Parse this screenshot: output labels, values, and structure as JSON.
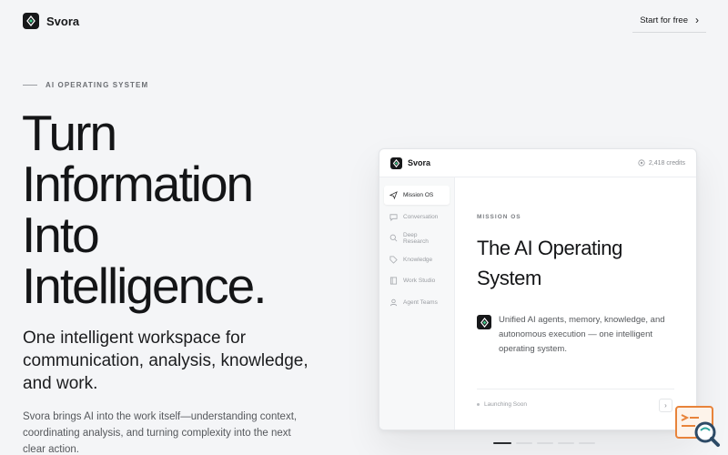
{
  "header": {
    "brand": "Svora",
    "cta_label": "Start for free",
    "cta_icon": "chevron-right-icon"
  },
  "hero": {
    "eyebrow": "AI OPERATING SYSTEM",
    "headline": [
      "Turn",
      "Information",
      "Into",
      "Intelligence."
    ],
    "subhead": "One intelligent workspace for communication, analysis, knowledge, and work.",
    "body": "Svora brings AI into the work itself—understanding context, coordinating analysis, and turning complexity into the next clear action."
  },
  "mock": {
    "brand": "Svora",
    "credits": "2,418 credits",
    "nav": [
      {
        "label": "Mission OS",
        "icon": "send-icon",
        "active": true
      },
      {
        "label": "Conversation",
        "icon": "chat-icon",
        "active": false
      },
      {
        "label": "Deep Research",
        "icon": "search-icon",
        "active": false
      },
      {
        "label": "Knowledge",
        "icon": "tag-icon",
        "active": false
      },
      {
        "label": "Work Studio",
        "icon": "book-icon",
        "active": false
      },
      {
        "label": "Agent Teams",
        "icon": "agent-icon",
        "active": false
      }
    ],
    "eyebrow": "MISSION OS",
    "title": "The AI Operating System",
    "description": "Unified AI agents, memory, knowledge, and autonomous execution — one intelligent operating system.",
    "status": "Launching Soon",
    "next_label": "›"
  },
  "pager": {
    "count": 5,
    "active": 0
  },
  "colors": {
    "accent": "#3fd08c",
    "ink": "#17181a",
    "background": "#f4f5f7",
    "widget": "#e8833a"
  }
}
